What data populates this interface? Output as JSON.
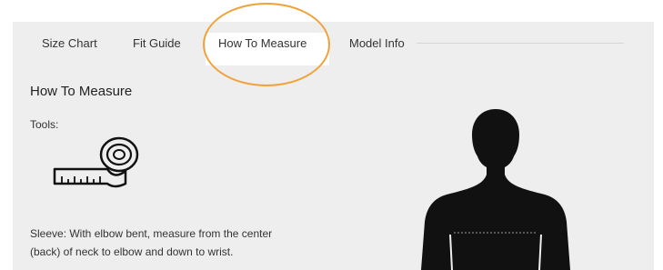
{
  "tabs": [
    {
      "label": "Size Chart",
      "active": false
    },
    {
      "label": "Fit Guide",
      "active": false
    },
    {
      "label": "How To Measure",
      "active": true
    },
    {
      "label": "Model Info",
      "active": false
    }
  ],
  "content": {
    "title": "How To Measure",
    "tools_label": "Tools:",
    "tool_icon": "measuring-tape-icon",
    "instruction_line1": "Sleeve: With elbow bent, measure from the center",
    "instruction_line2": "(back) of neck to elbow and down to wrist."
  },
  "figure": {
    "icon": "body-silhouette-icon"
  },
  "colors": {
    "panel_bg": "#eeeeee",
    "active_tab_bg": "#ffffff",
    "highlight": "#f0a23a",
    "silhouette": "#111111"
  }
}
